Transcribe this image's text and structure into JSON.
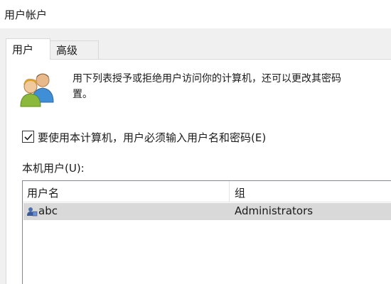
{
  "window": {
    "title": "用户帐户"
  },
  "tabs": [
    {
      "label": "用户",
      "selected": true
    },
    {
      "label": "高级",
      "selected": false
    }
  ],
  "panel": {
    "description_line1": "用下列表授予或拒绝用户访问你的计算机，还可以更改其密码",
    "description_line2": "置。",
    "checkbox": {
      "label": "要使用本计算机，用户必须输入用户名和密码(E)",
      "checked": true
    },
    "local_users_label": "本机用户(U):",
    "user_list": {
      "columns": [
        "用户名",
        "组"
      ],
      "rows": [
        {
          "name": "abc",
          "group": "Administrators",
          "selected": true
        }
      ]
    }
  },
  "icons": {
    "users": "users-icon",
    "user_row": "user-icon",
    "check": "checkmark-icon"
  }
}
